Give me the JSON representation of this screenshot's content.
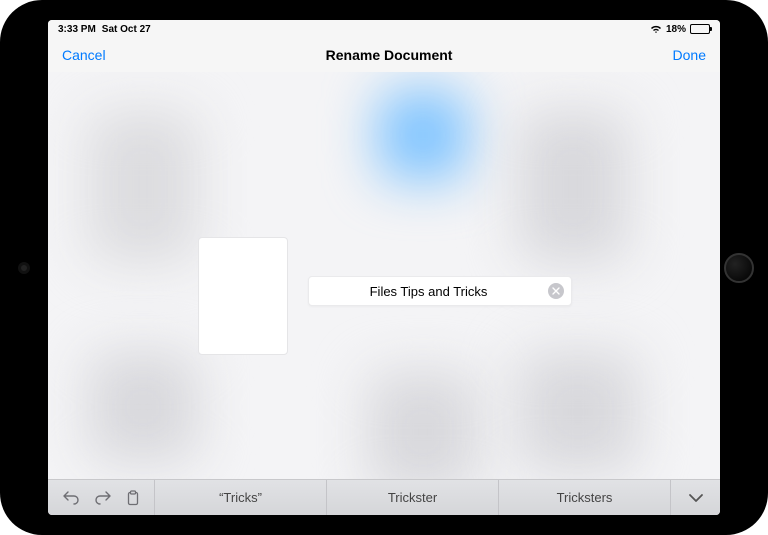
{
  "status": {
    "time": "3:33 PM",
    "date": "Sat Oct 27",
    "battery_pct": "18%"
  },
  "nav": {
    "cancel": "Cancel",
    "title": "Rename Document",
    "done": "Done"
  },
  "rename": {
    "value": "Files Tips and Tricks"
  },
  "keyboard": {
    "suggestion1": "“Tricks”",
    "suggestion2": "Trickster",
    "suggestion3": "Tricksters"
  }
}
